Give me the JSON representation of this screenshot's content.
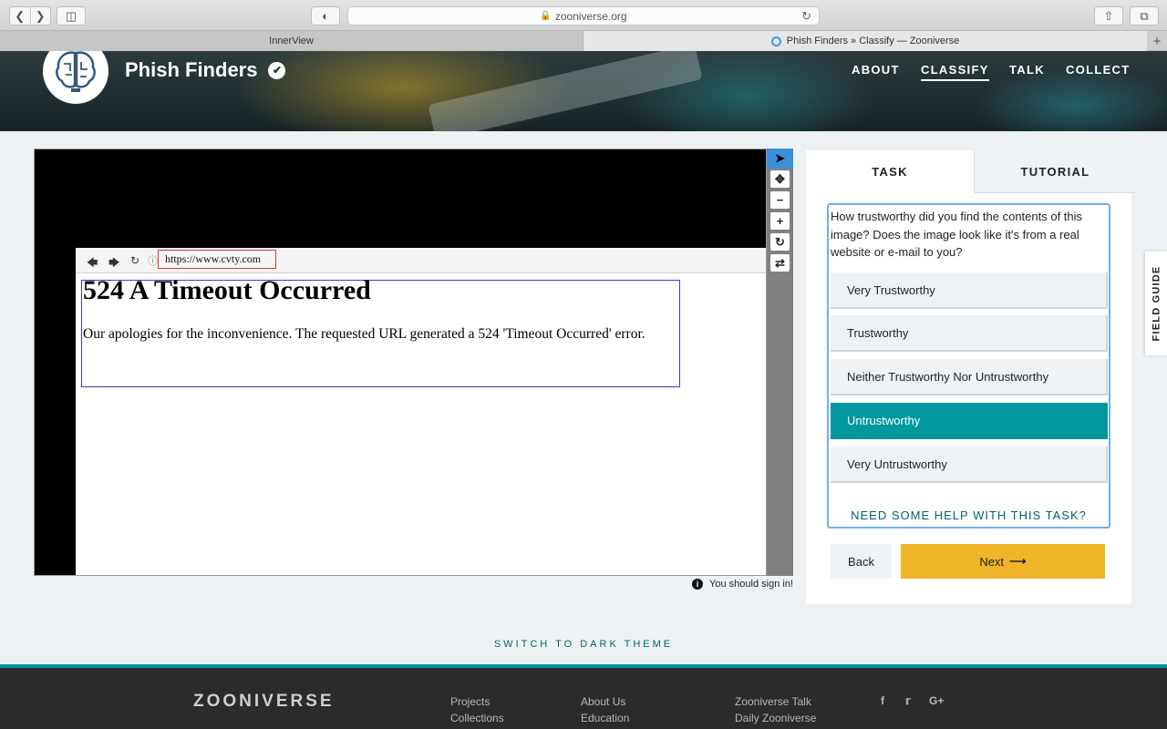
{
  "browser": {
    "url": "zooniverse.org",
    "tabs": [
      {
        "label": "InnerView"
      },
      {
        "label": "Phish Finders » Classify — Zooniverse"
      }
    ]
  },
  "header": {
    "project_name": "Phish Finders",
    "nav": [
      "ABOUT",
      "CLASSIFY",
      "TALK",
      "COLLECT"
    ],
    "active_nav": "CLASSIFY"
  },
  "subject": {
    "shot_url": "https://www.cvty.com",
    "heading": "524 A Timeout Occurred",
    "body": "Our apologies for the inconvenience. The requested URL generated a 524 'Timeout Occurred' error."
  },
  "viewer": {
    "signin_note": "You should sign in!",
    "tools": [
      "pointer-icon",
      "move-icon",
      "zoom-out-icon",
      "zoom-in-icon",
      "rotate-icon",
      "reset-icon"
    ]
  },
  "task": {
    "tab_task": "TASK",
    "tab_tutorial": "TUTORIAL",
    "question": "How trustworthy did you find the contents of this image? Does the image look like it's from a real website or e-mail to you?",
    "answers": [
      "Very Trustworthy",
      "Trustworthy",
      "Neither Trustworthy Nor Untrustworthy",
      "Untrustworthy",
      "Very Untrustworthy"
    ],
    "selected_answer": "Untrustworthy",
    "help": "NEED SOME HELP WITH THIS TASK?",
    "back": "Back",
    "next": "Next"
  },
  "field_guide": "FIELD GUIDE",
  "dark_theme": "SWITCH TO DARK THEME",
  "footer": {
    "logo": "ZOONIVERSE",
    "col1": [
      "Projects",
      "Collections"
    ],
    "col2": [
      "About Us",
      "Education"
    ],
    "col3": [
      "Zooniverse Talk",
      "Daily Zooniverse"
    ],
    "social": [
      "f",
      "t",
      "G+"
    ]
  },
  "colors": {
    "teal": "#00979d",
    "next_yellow": "#f0b429",
    "focus_blue": "#70aef0"
  }
}
